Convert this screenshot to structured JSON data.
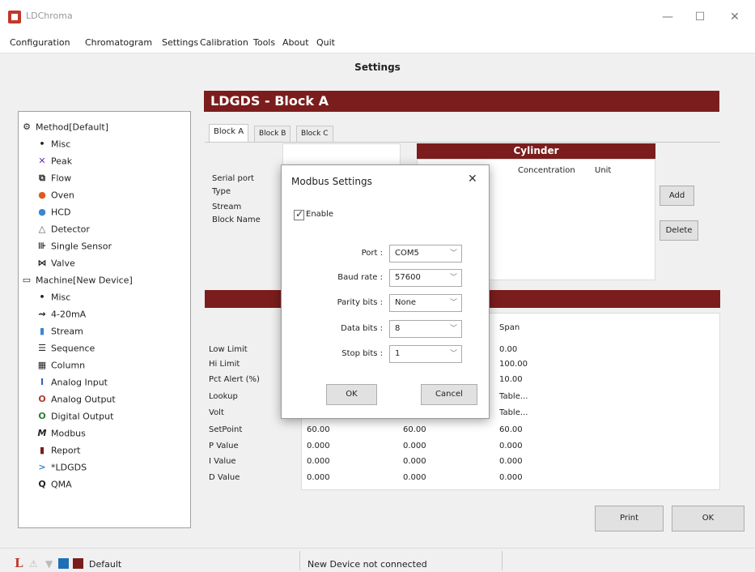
{
  "app_title": "LDChroma",
  "window_controls": {
    "minimize": "—",
    "maximize": "☐",
    "close": "✕"
  },
  "menu": [
    "Configuration",
    "Chromatogram",
    "Settings",
    "Calibration",
    "Tools",
    "About",
    "Quit"
  ],
  "window_title": "Settings",
  "sidebar": {
    "items": [
      {
        "label": "Method[Default]",
        "icon": "method-icon"
      },
      {
        "label": "Misc",
        "icon": "bullet-icon"
      },
      {
        "label": "Peak",
        "icon": "peak-icon"
      },
      {
        "label": "Flow",
        "icon": "flow-icon"
      },
      {
        "label": "Oven",
        "icon": "oven-icon"
      },
      {
        "label": "HCD",
        "icon": "hcd-icon"
      },
      {
        "label": "Detector",
        "icon": "detector-icon"
      },
      {
        "label": "Single Sensor",
        "icon": "sensor-icon"
      },
      {
        "label": "Valve",
        "icon": "valve-icon"
      },
      {
        "label": "Machine[New Device]",
        "icon": "machine-icon"
      },
      {
        "label": "Misc",
        "icon": "bullet-icon"
      },
      {
        "label": "4-20mA",
        "icon": "signal-icon"
      },
      {
        "label": "Stream",
        "icon": "stream-icon"
      },
      {
        "label": "Sequence",
        "icon": "sequence-icon"
      },
      {
        "label": "Column",
        "icon": "column-icon"
      },
      {
        "label": "Analog Input",
        "icon": "analog-input-icon"
      },
      {
        "label": "Analog Output",
        "icon": "analog-output-icon"
      },
      {
        "label": "Digital Output",
        "icon": "digital-output-icon"
      },
      {
        "label": "Modbus",
        "icon": "modbus-icon"
      },
      {
        "label": "Report",
        "icon": "report-icon"
      },
      {
        "label": "*LDGDS",
        "icon": "ldgds-icon"
      },
      {
        "label": "QMA",
        "icon": "qma-icon"
      }
    ]
  },
  "main": {
    "header": "LDGDS - Block A",
    "tabs": [
      "Block A",
      "Block B",
      "Block C"
    ],
    "fields": [
      "Serial port",
      "Type",
      "Stream",
      "Block Name"
    ],
    "cylinder": {
      "title": "Cylinder",
      "columns": [
        "Concentration",
        "Unit"
      ]
    },
    "add_label": "Add",
    "delete_label": "Delete",
    "table": {
      "span_header": "Span",
      "rows": [
        {
          "label": "Low Limit",
          "c1": "",
          "c2": "",
          "c3": "0.00"
        },
        {
          "label": "Hi Limit",
          "c1": "",
          "c2": "",
          "c3": "100.00"
        },
        {
          "label": "Pct Alert (%)",
          "c1": "",
          "c2": "",
          "c3": "10.00"
        },
        {
          "label": "Lookup",
          "c1": "",
          "c2": "",
          "c3": "Table..."
        },
        {
          "label": "Volt",
          "c1": "",
          "c2": "",
          "c3": "Table..."
        },
        {
          "label": "SetPoint",
          "c1": "60.00",
          "c2": "60.00",
          "c3": "60.00"
        },
        {
          "label": "P Value",
          "c1": "0.000",
          "c2": "0.000",
          "c3": "0.000"
        },
        {
          "label": "I Value",
          "c1": "0.000",
          "c2": "0.000",
          "c3": "0.000"
        },
        {
          "label": "D Value",
          "c1": "0.000",
          "c2": "0.000",
          "c3": "0.000"
        }
      ]
    },
    "print_label": "Print",
    "ok_label": "OK"
  },
  "modal": {
    "title": "Modbus Settings",
    "close": "✕",
    "enable_label": "Enable",
    "enabled": true,
    "fields": [
      {
        "label": "Port :",
        "value": "COM5"
      },
      {
        "label": "Baud rate :",
        "value": "57600"
      },
      {
        "label": "Parity bits :",
        "value": "None"
      },
      {
        "label": "Data bits :",
        "value": "8"
      },
      {
        "label": "Stop bits :",
        "value": "1"
      }
    ],
    "ok_label": "OK",
    "cancel_label": "Cancel"
  },
  "status": {
    "logo_letter": "L",
    "method": "Default",
    "connection": "New Device not connected"
  },
  "colors": {
    "accent": "#7b1d1d",
    "background": "#f0f0f0"
  }
}
